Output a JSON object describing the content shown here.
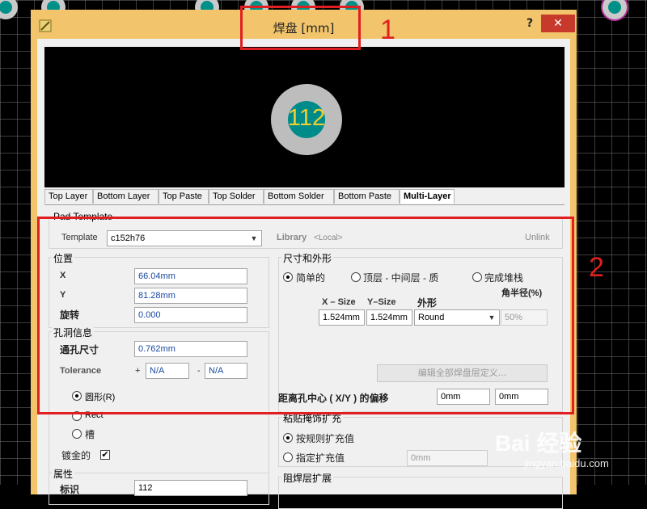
{
  "window": {
    "title": "焊盘 [mm]",
    "help_label": "?",
    "close_label": "✕"
  },
  "preview": {
    "pad_label": "112",
    "colors": {
      "pad_ring": "#bdbdbd",
      "hole": "#008b8b",
      "label": "#f0d030"
    }
  },
  "tabs": [
    "Top Layer",
    "Bottom Layer",
    "Top Paste",
    "Top Solder",
    "Bottom Solder",
    "Bottom Paste",
    "Multi-Layer"
  ],
  "pad_template": {
    "group_label": "Pad Template",
    "template_label": "Template",
    "template_value": "c152h76",
    "library_label": "Library",
    "library_value": "<Local>",
    "unlink_label": "Unlink"
  },
  "position": {
    "group_label": "位置",
    "x_label": "X",
    "x_value": "66.04mm",
    "y_label": "Y",
    "y_value": "81.28mm",
    "rotation_label": "旋转",
    "rotation_value": "0.000"
  },
  "hole": {
    "group_label": "孔洞信息",
    "size_label": "通孔尺寸",
    "size_value": "0.762mm",
    "tolerance_label": "Tolerance",
    "plus_sign": "+",
    "minus_sign": "-",
    "tol_plus": "N/A",
    "tol_minus": "N/A",
    "round_label": "圆形(R)",
    "rect_label": "Rect",
    "slot_label": "槽",
    "plated_label": "镀金的",
    "plated_mark": "✔"
  },
  "size_shape": {
    "group_label": "尺寸和外形",
    "simple_label": "简单的",
    "topmid_label": "顶层 - 中间层 - 质",
    "fullstack_label": "完成堆栈",
    "corner_label": "角半径(%)",
    "xsize_header": "X – Size",
    "ysize_header": "Y–Size",
    "shape_header": "外形",
    "xsize_value": "1.524mm",
    "ysize_value": "1.524mm",
    "shape_value": "Round",
    "corner_value": "50%",
    "edit_button": "编辑全部焊盘层定义...",
    "offset_label": "距离孔中心 ( X/Y ) 的偏移",
    "offset_x": "0mm",
    "offset_y": "0mm"
  },
  "paste": {
    "group_label": "粘贴掩饰扩充",
    "rule_label": "按规则扩充值",
    "specified_label": "指定扩充值",
    "specified_value": "0mm"
  },
  "solder": {
    "group_label": "阻焊层扩展"
  },
  "properties": {
    "group_label": "属性",
    "designator_label": "标识",
    "designator_value": "112"
  },
  "annotations": {
    "label_1": "1",
    "label_2": "2",
    "color": "#e02020"
  },
  "watermark": {
    "brand": "Bai 经验",
    "url": "jingyan.baidu.com"
  }
}
